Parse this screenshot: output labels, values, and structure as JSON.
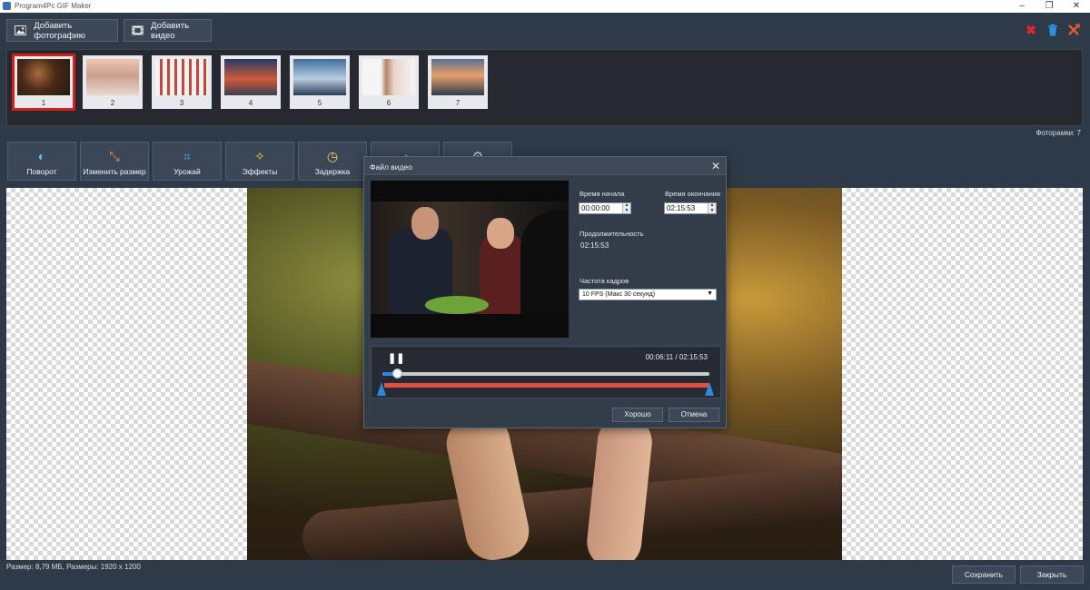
{
  "window": {
    "title": "Program4Pc GIF Maker",
    "minimize": "–",
    "restore": "❐",
    "close": "✕"
  },
  "toolbar": {
    "add_photo_label": "Добавить фотографию",
    "add_video_label": "Добавить видео",
    "icons": {
      "delete_red": "✖",
      "trash": "🗑",
      "clear": "✕"
    },
    "accent_colors": {
      "delete": "#e0252b",
      "trash": "#2d8fe0",
      "clear": "#e55a28"
    }
  },
  "frames": {
    "items": [
      {
        "num": "1",
        "selected": true
      },
      {
        "num": "2",
        "selected": false
      },
      {
        "num": "3",
        "selected": false
      },
      {
        "num": "4",
        "selected": false
      },
      {
        "num": "5",
        "selected": false
      },
      {
        "num": "6",
        "selected": false
      },
      {
        "num": "7",
        "selected": false
      }
    ],
    "count_label": "Фоторамки: 7"
  },
  "tools": {
    "rotate": "Поворот",
    "resize": "Изменить размер",
    "crop": "Урожай",
    "effects": "Эффекты",
    "delay": "Задержка",
    "icons": {
      "rotate": "◐",
      "resize": "⤡",
      "crop": "⌗",
      "effects": "✧",
      "delay": "◷",
      "extra1": "◔",
      "extra2": "⚙"
    }
  },
  "dialog": {
    "title": "Файл видео",
    "start_label": "Время начала",
    "start_value": "00:00:00",
    "end_label": "Время окончания",
    "end_value": "02:15:53",
    "duration_label": "Продолжительность",
    "duration_value": "02:15:53",
    "fps_label": "Частота кадров",
    "fps_value": "10 FPS  (Макс 30 секунд)",
    "time_current": "00:06:11",
    "time_separator": "/",
    "time_total": "02:15:53",
    "playback_progress": 0.045,
    "ok_label": "Хорошо",
    "cancel_label": "Отмена"
  },
  "status": {
    "text": "Размер: 8,79 МБ,   Размеры: 1920 x 1200"
  },
  "footer": {
    "save_label": "Сохранить",
    "close_label": "Закрыть"
  }
}
